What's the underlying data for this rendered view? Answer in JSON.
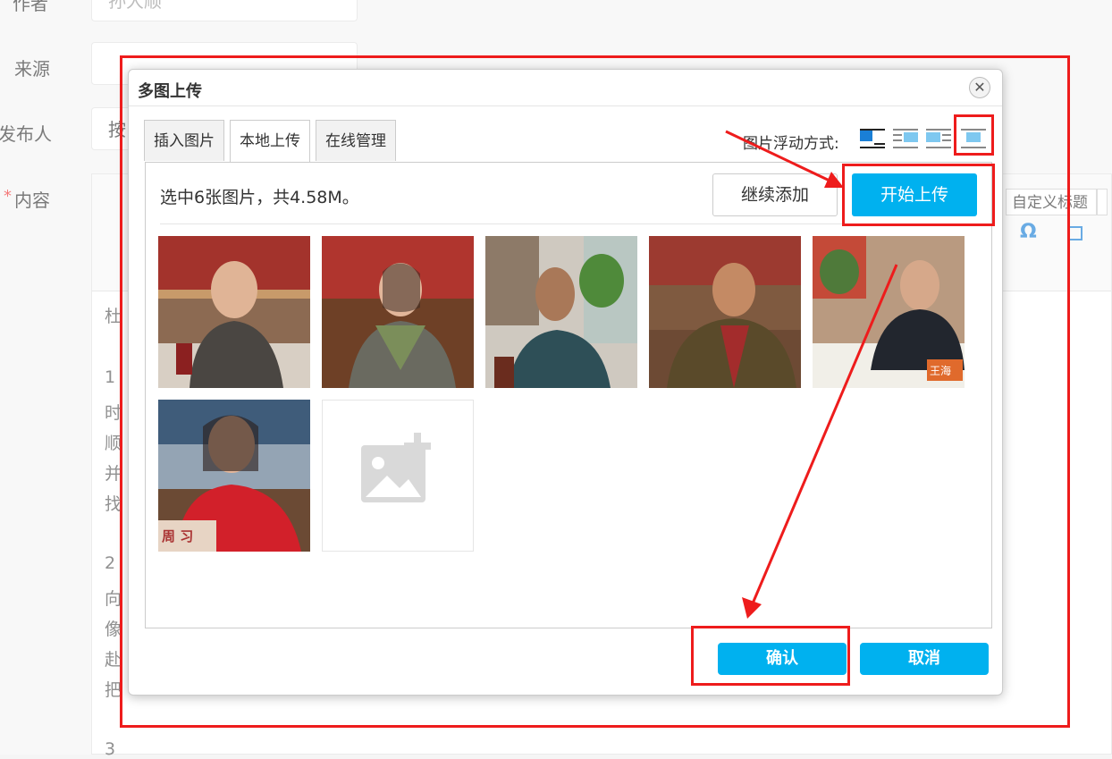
{
  "form": {
    "author_label": "作者",
    "author_value": "孙大顺",
    "source_label": "来源",
    "publisher_label": "发布人",
    "publisher_value": "按",
    "content_label": "内容",
    "required_mark": "*"
  },
  "editor": {
    "custom_heading": "自定义标题",
    "omega_icon": "Ω",
    "lines": [
      "杜",
      "1",
      "时",
      "顺",
      "并",
      "找",
      "2",
      "向",
      "像",
      "赴",
      "把",
      "3"
    ]
  },
  "dialog": {
    "title": "多图上传",
    "close_icon": "close-icon",
    "tabs": [
      {
        "label": "插入图片"
      },
      {
        "label": "本地上传"
      },
      {
        "label": "在线管理"
      }
    ],
    "float_label": "图片浮动方式:",
    "status_text": "选中6张图片，共4.58M。",
    "continue_label": "继续添加",
    "start_label": "开始上传",
    "confirm_label": "确认",
    "cancel_label": "取消",
    "photo_tags": [
      "王海",
      "周 习"
    ]
  },
  "colors": {
    "accent": "#00b1ef",
    "highlight": "#ee1c1c"
  }
}
